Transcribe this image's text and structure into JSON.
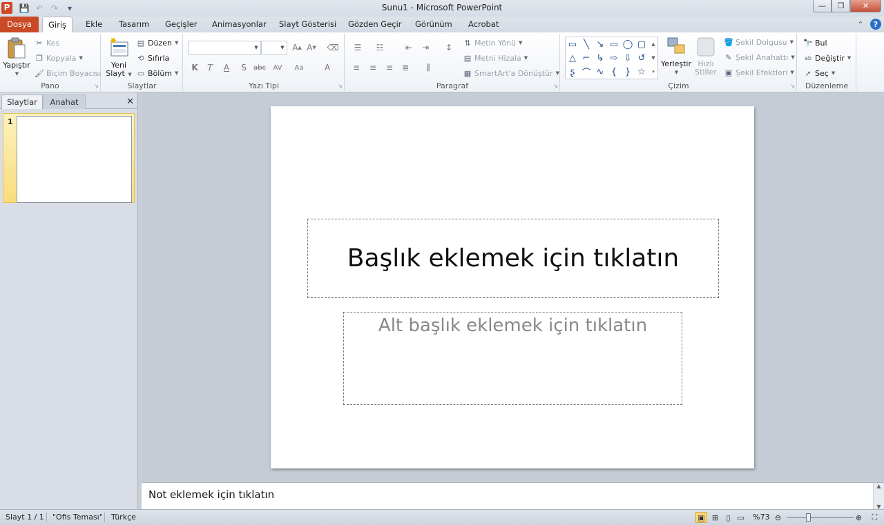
{
  "window": {
    "app_icon_letter": "P",
    "title": "Sunu1 - Microsoft PowerPoint",
    "min": "—",
    "max": "❐",
    "close": "✕"
  },
  "tabs": {
    "file": "Dosya",
    "items": [
      "Giriş",
      "Ekle",
      "Tasarım",
      "Geçişler",
      "Animasyonlar",
      "Slayt Gösterisi",
      "Gözden Geçir",
      "Görünüm",
      "Acrobat"
    ]
  },
  "ribbon": {
    "pano": {
      "label": "Pano",
      "paste": "Yapıştır",
      "cut": "Kes",
      "copy": "Kopyala",
      "format_painter": "Biçim Boyacısı"
    },
    "slaytlar": {
      "label": "Slaytlar",
      "new_slide_line1": "Yeni",
      "new_slide_line2": "Slayt",
      "layout": "Düzen",
      "reset": "Sıfırla",
      "section": "Bölüm"
    },
    "font": {
      "label": "Yazı Tipi",
      "font_name": "",
      "font_size": ""
    },
    "paragraph": {
      "label": "Paragraf",
      "text_direction": "Metin Yönü",
      "align_text": "Metni Hizala",
      "smartart": "SmartArt'a Dönüştür"
    },
    "drawing": {
      "label": "Çizim",
      "arrange": "Yerleştir",
      "quick_styles_line1": "Hızlı",
      "quick_styles_line2": "Stiller",
      "shape_fill": "Şekil Dolgusu",
      "shape_outline": "Şekil Anahattı",
      "shape_effects": "Şekil Efektleri"
    },
    "editing": {
      "label": "Düzenleme",
      "find": "Bul",
      "replace": "Değiştir",
      "select": "Seç"
    }
  },
  "left_pane": {
    "tab_slides": "Slaytlar",
    "tab_outline": "Anahat",
    "close": "✕",
    "slide_number": "1"
  },
  "slide": {
    "title_placeholder": "Başlık eklemek için tıklatın",
    "subtitle_placeholder": "Alt başlık eklemek için tıklatın"
  },
  "notes": {
    "placeholder": "Not eklemek için tıklatın"
  },
  "status": {
    "slide_info": "Slayt 1 / 1",
    "theme": "\"Ofis Teması\"",
    "language": "Türkçe",
    "zoom": "%73",
    "zoom_fraction": 0.73
  }
}
